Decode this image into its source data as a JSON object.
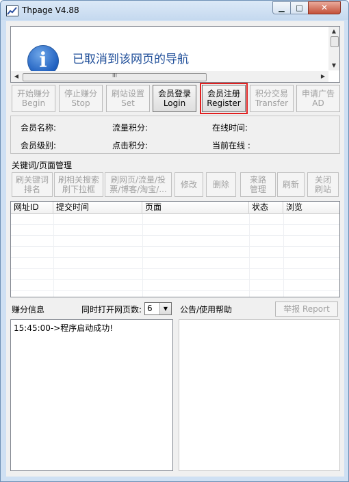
{
  "window": {
    "title": "Thpage V4.88",
    "minimize_glyph": "▁",
    "maximize_glyph": "□",
    "close_glyph": "✕"
  },
  "browser": {
    "message": "已取消到该网页的导航",
    "info_glyph": "i",
    "hscroll_glyph": "III"
  },
  "toolbar": [
    {
      "cn": "开始赚分",
      "en": "Begin",
      "enabled": false
    },
    {
      "cn": "停止赚分",
      "en": "Stop",
      "enabled": false
    },
    {
      "cn": "刷站设置",
      "en": "Set",
      "enabled": false
    },
    {
      "cn": "会员登录",
      "en": "Login",
      "enabled": true
    },
    {
      "cn": "会员注册",
      "en": "Register",
      "enabled": true,
      "highlighted": true
    },
    {
      "cn": "积分交易",
      "en": "Transfer",
      "enabled": false
    },
    {
      "cn": "申请广告",
      "en": "AD",
      "enabled": false
    }
  ],
  "member": {
    "name_label": "会员名称:",
    "traffic_label": "流量积分:",
    "online_time_label": "在线时间:",
    "level_label": "会员级别:",
    "click_label": "点击积分:",
    "current_online_label": "当前在线 :"
  },
  "keyword_section": {
    "title": "关键词/页面管理",
    "buttons": [
      {
        "line1": "刷关键词",
        "line2": "排名"
      },
      {
        "line1": "刷相关搜索",
        "line2": "刷下拉框"
      },
      {
        "line1": "刷网页/流量/投",
        "line2": "票/博客/淘宝/..."
      },
      {
        "line1": "修改",
        "line2": ""
      },
      {
        "line1": "删除",
        "line2": ""
      },
      {
        "line1": "来路",
        "line2": "管理"
      },
      {
        "line1": "刷新",
        "line2": ""
      },
      {
        "line1": "关闭",
        "line2": "刷站"
      }
    ]
  },
  "table": {
    "columns": [
      "网址ID",
      "提交时间",
      "页面",
      "状态",
      "浏览"
    ],
    "rows": []
  },
  "earnings": {
    "label": "赚分信息",
    "pages_label": "同时打开网页数:",
    "pages_value": "6",
    "log": [
      "15:45:00->程序启动成功!"
    ]
  },
  "notice": {
    "label": "公告/使用帮助",
    "report_button": "举报 Report"
  }
}
